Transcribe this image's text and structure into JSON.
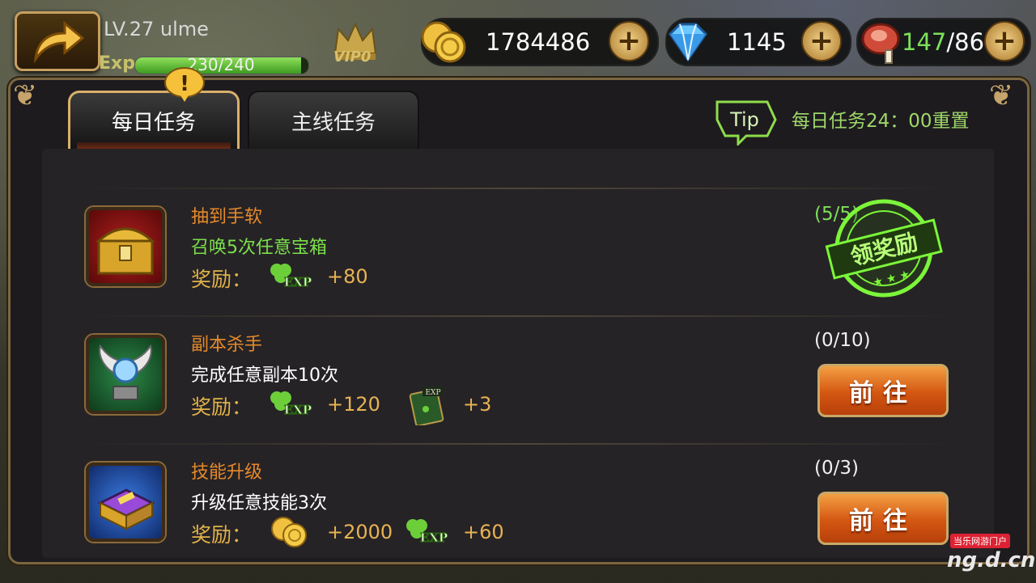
{
  "header": {
    "player_level": "LV.27 ulme",
    "exp_label": "Exp",
    "exp_text": "230/240",
    "exp_progress": 0.958,
    "vip_label": "VIP0",
    "gold": "1784486",
    "diamonds": "1145",
    "stamina_current": "147",
    "stamina_sep": "/86",
    "plus_symbol": "+"
  },
  "tabs": {
    "daily": "每日任务",
    "main": "主线任务",
    "alert_symbol": "!"
  },
  "tip": {
    "icon_label": "Tip",
    "text": "每日任务24：00重置"
  },
  "quests": [
    {
      "name": "抽到手软",
      "desc": "召唤5次任意宝箱",
      "reward_label": "奖励：",
      "rewards": [
        {
          "icon": "clover-exp-icon",
          "amount": "+80"
        }
      ],
      "progress": "(5/5)",
      "status": "claim",
      "claim_stamp": "领奖励"
    },
    {
      "name": "副本杀手",
      "desc": "完成任意副本10次",
      "reward_label": "奖励：",
      "rewards": [
        {
          "icon": "clover-exp-icon",
          "amount": "+120"
        },
        {
          "icon": "exp-card-icon",
          "amount": "+3"
        }
      ],
      "progress": "(0/10)",
      "status": "go",
      "button": "前往"
    },
    {
      "name": "技能升级",
      "desc": "升级任意技能3次",
      "reward_label": "奖励：",
      "rewards": [
        {
          "icon": "gold-coin-icon",
          "amount": "+2000"
        },
        {
          "icon": "clover-exp-icon",
          "amount": "+60"
        }
      ],
      "progress": "(0/3)",
      "status": "go",
      "button": "前往"
    }
  ],
  "colors": {
    "quest_name": "#e58a2a",
    "desc_claimable": "#7be04a",
    "desc_default": "#ffffff",
    "reward_amount": "#e8b252",
    "stamina_current": "#7ce05a",
    "claim_stamp": "#7cf53a"
  },
  "watermark": {
    "line1": "当乐网游门户",
    "line2": "ng.d.cn"
  }
}
